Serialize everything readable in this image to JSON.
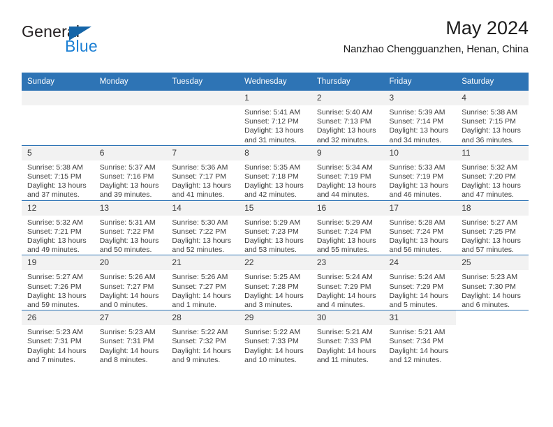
{
  "brand": {
    "name_part1": "General",
    "name_part2": "Blue",
    "logo_icon": "triangle-flag-icon"
  },
  "header": {
    "month_title": "May 2024",
    "location": "Nanzhao Chengguanzhen, Henan, China"
  },
  "theme": {
    "header_blue": "#2E74B5",
    "brand_blue": "#1B7FD4",
    "daynum_band": "#F2F2F2"
  },
  "calendar": {
    "weekday_headers": [
      "Sunday",
      "Monday",
      "Tuesday",
      "Wednesday",
      "Thursday",
      "Friday",
      "Saturday"
    ],
    "weeks": [
      [
        {
          "day": "",
          "empty": true,
          "band": true,
          "sunrise": "",
          "sunset": "",
          "daylight1": "",
          "daylight2": ""
        },
        {
          "day": "",
          "empty": true,
          "band": true,
          "sunrise": "",
          "sunset": "",
          "daylight1": "",
          "daylight2": ""
        },
        {
          "day": "",
          "empty": true,
          "band": true,
          "sunrise": "",
          "sunset": "",
          "daylight1": "",
          "daylight2": ""
        },
        {
          "day": "1",
          "sunrise": "Sunrise: 5:41 AM",
          "sunset": "Sunset: 7:12 PM",
          "daylight1": "Daylight: 13 hours",
          "daylight2": "and 31 minutes."
        },
        {
          "day": "2",
          "sunrise": "Sunrise: 5:40 AM",
          "sunset": "Sunset: 7:13 PM",
          "daylight1": "Daylight: 13 hours",
          "daylight2": "and 32 minutes."
        },
        {
          "day": "3",
          "sunrise": "Sunrise: 5:39 AM",
          "sunset": "Sunset: 7:14 PM",
          "daylight1": "Daylight: 13 hours",
          "daylight2": "and 34 minutes."
        },
        {
          "day": "4",
          "sunrise": "Sunrise: 5:38 AM",
          "sunset": "Sunset: 7:15 PM",
          "daylight1": "Daylight: 13 hours",
          "daylight2": "and 36 minutes."
        }
      ],
      [
        {
          "day": "5",
          "sunrise": "Sunrise: 5:38 AM",
          "sunset": "Sunset: 7:15 PM",
          "daylight1": "Daylight: 13 hours",
          "daylight2": "and 37 minutes."
        },
        {
          "day": "6",
          "sunrise": "Sunrise: 5:37 AM",
          "sunset": "Sunset: 7:16 PM",
          "daylight1": "Daylight: 13 hours",
          "daylight2": "and 39 minutes."
        },
        {
          "day": "7",
          "sunrise": "Sunrise: 5:36 AM",
          "sunset": "Sunset: 7:17 PM",
          "daylight1": "Daylight: 13 hours",
          "daylight2": "and 41 minutes."
        },
        {
          "day": "8",
          "sunrise": "Sunrise: 5:35 AM",
          "sunset": "Sunset: 7:18 PM",
          "daylight1": "Daylight: 13 hours",
          "daylight2": "and 42 minutes."
        },
        {
          "day": "9",
          "sunrise": "Sunrise: 5:34 AM",
          "sunset": "Sunset: 7:19 PM",
          "daylight1": "Daylight: 13 hours",
          "daylight2": "and 44 minutes."
        },
        {
          "day": "10",
          "sunrise": "Sunrise: 5:33 AM",
          "sunset": "Sunset: 7:19 PM",
          "daylight1": "Daylight: 13 hours",
          "daylight2": "and 46 minutes."
        },
        {
          "day": "11",
          "sunrise": "Sunrise: 5:32 AM",
          "sunset": "Sunset: 7:20 PM",
          "daylight1": "Daylight: 13 hours",
          "daylight2": "and 47 minutes."
        }
      ],
      [
        {
          "day": "12",
          "sunrise": "Sunrise: 5:32 AM",
          "sunset": "Sunset: 7:21 PM",
          "daylight1": "Daylight: 13 hours",
          "daylight2": "and 49 minutes."
        },
        {
          "day": "13",
          "sunrise": "Sunrise: 5:31 AM",
          "sunset": "Sunset: 7:22 PM",
          "daylight1": "Daylight: 13 hours",
          "daylight2": "and 50 minutes."
        },
        {
          "day": "14",
          "sunrise": "Sunrise: 5:30 AM",
          "sunset": "Sunset: 7:22 PM",
          "daylight1": "Daylight: 13 hours",
          "daylight2": "and 52 minutes."
        },
        {
          "day": "15",
          "sunrise": "Sunrise: 5:29 AM",
          "sunset": "Sunset: 7:23 PM",
          "daylight1": "Daylight: 13 hours",
          "daylight2": "and 53 minutes."
        },
        {
          "day": "16",
          "sunrise": "Sunrise: 5:29 AM",
          "sunset": "Sunset: 7:24 PM",
          "daylight1": "Daylight: 13 hours",
          "daylight2": "and 55 minutes."
        },
        {
          "day": "17",
          "sunrise": "Sunrise: 5:28 AM",
          "sunset": "Sunset: 7:24 PM",
          "daylight1": "Daylight: 13 hours",
          "daylight2": "and 56 minutes."
        },
        {
          "day": "18",
          "sunrise": "Sunrise: 5:27 AM",
          "sunset": "Sunset: 7:25 PM",
          "daylight1": "Daylight: 13 hours",
          "daylight2": "and 57 minutes."
        }
      ],
      [
        {
          "day": "19",
          "sunrise": "Sunrise: 5:27 AM",
          "sunset": "Sunset: 7:26 PM",
          "daylight1": "Daylight: 13 hours",
          "daylight2": "and 59 minutes."
        },
        {
          "day": "20",
          "sunrise": "Sunrise: 5:26 AM",
          "sunset": "Sunset: 7:27 PM",
          "daylight1": "Daylight: 14 hours",
          "daylight2": "and 0 minutes."
        },
        {
          "day": "21",
          "sunrise": "Sunrise: 5:26 AM",
          "sunset": "Sunset: 7:27 PM",
          "daylight1": "Daylight: 14 hours",
          "daylight2": "and 1 minute."
        },
        {
          "day": "22",
          "sunrise": "Sunrise: 5:25 AM",
          "sunset": "Sunset: 7:28 PM",
          "daylight1": "Daylight: 14 hours",
          "daylight2": "and 3 minutes."
        },
        {
          "day": "23",
          "sunrise": "Sunrise: 5:24 AM",
          "sunset": "Sunset: 7:29 PM",
          "daylight1": "Daylight: 14 hours",
          "daylight2": "and 4 minutes."
        },
        {
          "day": "24",
          "sunrise": "Sunrise: 5:24 AM",
          "sunset": "Sunset: 7:29 PM",
          "daylight1": "Daylight: 14 hours",
          "daylight2": "and 5 minutes."
        },
        {
          "day": "25",
          "sunrise": "Sunrise: 5:23 AM",
          "sunset": "Sunset: 7:30 PM",
          "daylight1": "Daylight: 14 hours",
          "daylight2": "and 6 minutes."
        }
      ],
      [
        {
          "day": "26",
          "sunrise": "Sunrise: 5:23 AM",
          "sunset": "Sunset: 7:31 PM",
          "daylight1": "Daylight: 14 hours",
          "daylight2": "and 7 minutes."
        },
        {
          "day": "27",
          "sunrise": "Sunrise: 5:23 AM",
          "sunset": "Sunset: 7:31 PM",
          "daylight1": "Daylight: 14 hours",
          "daylight2": "and 8 minutes."
        },
        {
          "day": "28",
          "sunrise": "Sunrise: 5:22 AM",
          "sunset": "Sunset: 7:32 PM",
          "daylight1": "Daylight: 14 hours",
          "daylight2": "and 9 minutes."
        },
        {
          "day": "29",
          "sunrise": "Sunrise: 5:22 AM",
          "sunset": "Sunset: 7:33 PM",
          "daylight1": "Daylight: 14 hours",
          "daylight2": "and 10 minutes."
        },
        {
          "day": "30",
          "sunrise": "Sunrise: 5:21 AM",
          "sunset": "Sunset: 7:33 PM",
          "daylight1": "Daylight: 14 hours",
          "daylight2": "and 11 minutes."
        },
        {
          "day": "31",
          "sunrise": "Sunrise: 5:21 AM",
          "sunset": "Sunset: 7:34 PM",
          "daylight1": "Daylight: 14 hours",
          "daylight2": "and 12 minutes."
        },
        {
          "day": "",
          "empty": true,
          "band": false,
          "sunrise": "",
          "sunset": "",
          "daylight1": "",
          "daylight2": ""
        }
      ]
    ]
  }
}
